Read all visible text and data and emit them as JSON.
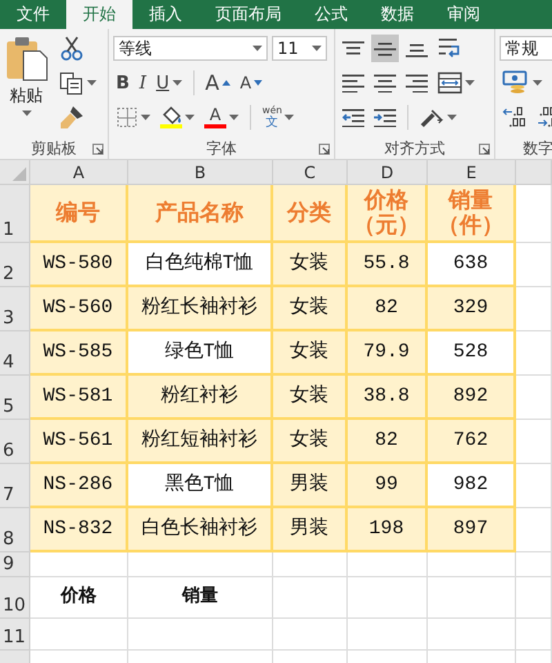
{
  "tabs": [
    {
      "label": "文件",
      "selected": false
    },
    {
      "label": "开始",
      "selected": true
    },
    {
      "label": "插入",
      "selected": false
    },
    {
      "label": "页面布局",
      "selected": false
    },
    {
      "label": "公式",
      "selected": false
    },
    {
      "label": "数据",
      "selected": false
    },
    {
      "label": "审阅",
      "selected": false
    }
  ],
  "ribbon": [
    {
      "label": "剪贴板",
      "large": {
        "label": "粘贴",
        "kind": "paste"
      },
      "rows": [
        {
          "tools": [
            {
              "kind": "cut"
            }
          ]
        },
        {
          "tools": [
            {
              "kind": "copy"
            }
          ]
        },
        {
          "tools": [
            {
              "kind": "brush"
            }
          ]
        }
      ]
    },
    {
      "label": "字体",
      "rows": [
        {
          "tools": [
            {
              "kind": "combo",
              "value": "等线"
            },
            {
              "kind": "combo",
              "value": "11"
            }
          ]
        },
        {
          "tools": [
            {
              "kind": "bold",
              "label": "B"
            },
            {
              "kind": "italic",
              "label": "I"
            },
            {
              "kind": "underline",
              "label": "U"
            },
            {
              "kind": "sep"
            },
            {
              "kind": "grow",
              "label": "A"
            },
            {
              "kind": "shrink",
              "label": "A"
            }
          ]
        },
        {
          "tools": [
            {
              "kind": "border"
            },
            {
              "kind": "fill",
              "color": "#ffff00"
            },
            {
              "kind": "fontcolor",
              "label": "A",
              "color": "#ff0000"
            },
            {
              "kind": "sep"
            },
            {
              "kind": "phonetic",
              "label": "wén",
              "sub": "文"
            }
          ]
        }
      ]
    },
    {
      "label": "对齐方式",
      "rows": [
        {
          "tools": [
            {
              "kind": "top",
              "selected": false
            },
            {
              "kind": "middle",
              "selected": true
            },
            {
              "kind": "bottom",
              "selected": false
            },
            {
              "kind": "wrap"
            }
          ]
        },
        {
          "tools": [
            {
              "kind": "left",
              "selected": false
            },
            {
              "kind": "center",
              "selected": false
            },
            {
              "kind": "right",
              "selected": false
            },
            {
              "kind": "merge"
            }
          ]
        },
        {
          "tools": [
            {
              "kind": "outdent"
            },
            {
              "kind": "indent"
            },
            {
              "kind": "sep"
            },
            {
              "kind": "orient"
            }
          ]
        }
      ]
    },
    {
      "label": "数字",
      "rows": [
        {
          "tools": [
            {
              "kind": "combo",
              "value": "常规"
            }
          ]
        },
        {
          "tools": [
            {
              "kind": "currency"
            }
          ]
        },
        {
          "tools": [
            {
              "kind": "incdec"
            },
            {
              "kind": "decdec"
            }
          ]
        }
      ]
    }
  ],
  "sheet": {
    "columns": [
      "A",
      "B",
      "C",
      "D",
      "E"
    ],
    "rows": [
      {
        "number": "1",
        "kind": "header",
        "cells": [
          {
            "text": "编号",
            "filled": true
          },
          {
            "text": "产品名称",
            "filled": true
          },
          {
            "text": "分类",
            "filled": true
          },
          {
            "text": "价格（元）",
            "filled": true
          },
          {
            "text": "销量（件）",
            "filled": true
          }
        ]
      },
      {
        "number": "2",
        "kind": "data",
        "cells": [
          {
            "text": "WS-580",
            "filled": true
          },
          {
            "text": "白色纯棉T恤",
            "filled": false
          },
          {
            "text": "女装",
            "filled": true
          },
          {
            "text": "55.8",
            "filled": true
          },
          {
            "text": "638",
            "filled": false
          }
        ]
      },
      {
        "number": "3",
        "kind": "data",
        "cells": [
          {
            "text": "WS-560",
            "filled": true
          },
          {
            "text": "粉红长袖衬衫",
            "filled": true
          },
          {
            "text": "女装",
            "filled": true
          },
          {
            "text": "82",
            "filled": true
          },
          {
            "text": "329",
            "filled": true
          }
        ]
      },
      {
        "number": "4",
        "kind": "data",
        "cells": [
          {
            "text": "WS-585",
            "filled": true
          },
          {
            "text": "绿色T恤",
            "filled": false
          },
          {
            "text": "女装",
            "filled": true
          },
          {
            "text": "79.9",
            "filled": true
          },
          {
            "text": "528",
            "filled": false
          }
        ]
      },
      {
        "number": "5",
        "kind": "data",
        "cells": [
          {
            "text": "WS-581",
            "filled": true
          },
          {
            "text": "粉红衬衫",
            "filled": true
          },
          {
            "text": "女装",
            "filled": true
          },
          {
            "text": "38.8",
            "filled": true
          },
          {
            "text": "892",
            "filled": true
          }
        ]
      },
      {
        "number": "6",
        "kind": "data",
        "cells": [
          {
            "text": "WS-561",
            "filled": true
          },
          {
            "text": "粉红短袖衬衫",
            "filled": true
          },
          {
            "text": "女装",
            "filled": true
          },
          {
            "text": "82",
            "filled": true
          },
          {
            "text": "762",
            "filled": true
          }
        ]
      },
      {
        "number": "7",
        "kind": "data",
        "cells": [
          {
            "text": "NS-286",
            "filled": true
          },
          {
            "text": "黑色T恤",
            "filled": false
          },
          {
            "text": "男装",
            "filled": true
          },
          {
            "text": "99",
            "filled": true
          },
          {
            "text": "982",
            "filled": false
          }
        ]
      },
      {
        "number": "8",
        "kind": "data",
        "cells": [
          {
            "text": "NS-832",
            "filled": true
          },
          {
            "text": "白色长袖衬衫",
            "filled": true
          },
          {
            "text": "男装",
            "filled": true
          },
          {
            "text": "198",
            "filled": true
          },
          {
            "text": "897",
            "filled": true
          }
        ]
      },
      {
        "number": "9",
        "kind": "blank",
        "cells": []
      },
      {
        "number": "10",
        "kind": "label",
        "cells": [
          {
            "text": "价格"
          },
          {
            "text": "销量"
          }
        ]
      },
      {
        "number": "11",
        "kind": "blank",
        "cells": []
      }
    ]
  }
}
